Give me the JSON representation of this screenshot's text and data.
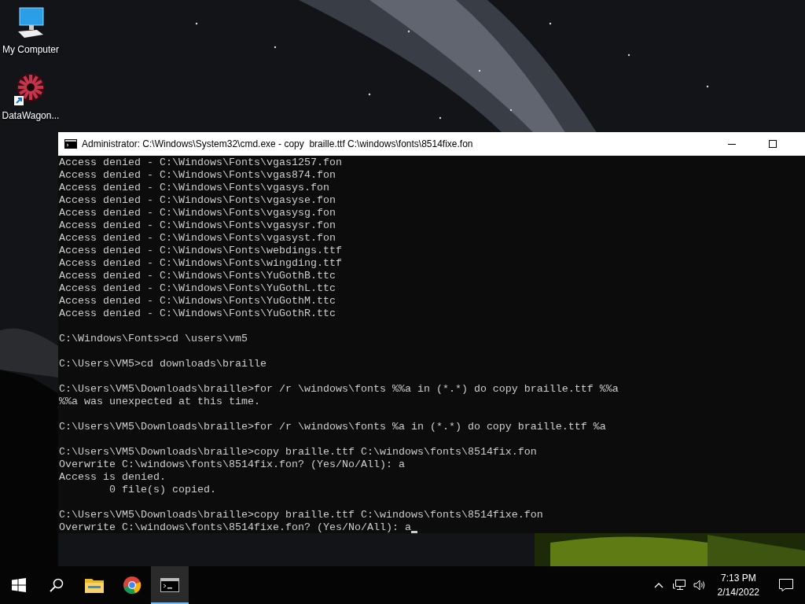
{
  "desktop_icons": [
    {
      "label": "My Computer",
      "kind": "computer"
    },
    {
      "label": "DataWagon...",
      "kind": "shortcut"
    }
  ],
  "window": {
    "title": "Administrator: C:\\Windows\\System32\\cmd.exe - copy  braille.ttf C:\\windows\\fonts\\8514fixe.fon",
    "console_blocks": [
      [
        "Access denied - C:\\Windows\\Fonts\\vgas1257.fon",
        "Access denied - C:\\Windows\\Fonts\\vgas874.fon",
        "Access denied - C:\\Windows\\Fonts\\vgasys.fon",
        "Access denied - C:\\Windows\\Fonts\\vgasyse.fon",
        "Access denied - C:\\Windows\\Fonts\\vgasysg.fon",
        "Access denied - C:\\Windows\\Fonts\\vgasysr.fon",
        "Access denied - C:\\Windows\\Fonts\\vgasyst.fon",
        "Access denied - C:\\Windows\\Fonts\\webdings.ttf",
        "Access denied - C:\\Windows\\Fonts\\wingding.ttf",
        "Access denied - C:\\Windows\\Fonts\\YuGothB.ttc",
        "Access denied - C:\\Windows\\Fonts\\YuGothL.ttc",
        "Access denied - C:\\Windows\\Fonts\\YuGothM.ttc",
        "Access denied - C:\\Windows\\Fonts\\YuGothR.ttc"
      ],
      [
        "C:\\Windows\\Fonts>cd \\users\\vm5"
      ],
      [
        "C:\\Users\\VM5>cd downloads\\braille"
      ],
      [
        "C:\\Users\\VM5\\Downloads\\braille>for /r \\windows\\fonts %%a in (*.*) do copy braille.ttf %%a",
        "%%a was unexpected at this time."
      ],
      [
        "C:\\Users\\VM5\\Downloads\\braille>for /r \\windows\\fonts %a in (*.*) do copy braille.ttf %a"
      ],
      [
        "C:\\Users\\VM5\\Downloads\\braille>copy braille.ttf C:\\windows\\fonts\\8514fix.fon",
        "Overwrite C:\\windows\\fonts\\8514fix.fon? (Yes/No/All): a",
        "Access is denied.",
        "        0 file(s) copied."
      ],
      [
        "C:\\Users\\VM5\\Downloads\\braille>copy braille.ttf C:\\windows\\fonts\\8514fixe.fon",
        "Overwrite C:\\windows\\fonts\\8514fixe.fon? (Yes/No/All): a"
      ]
    ]
  },
  "taskbar": {
    "apps": [
      {
        "kind": "explorer",
        "selected": false
      },
      {
        "kind": "chrome",
        "selected": false
      },
      {
        "kind": "cmd",
        "selected": true
      }
    ],
    "time": "7:13 PM",
    "date": "2/14/2022"
  }
}
